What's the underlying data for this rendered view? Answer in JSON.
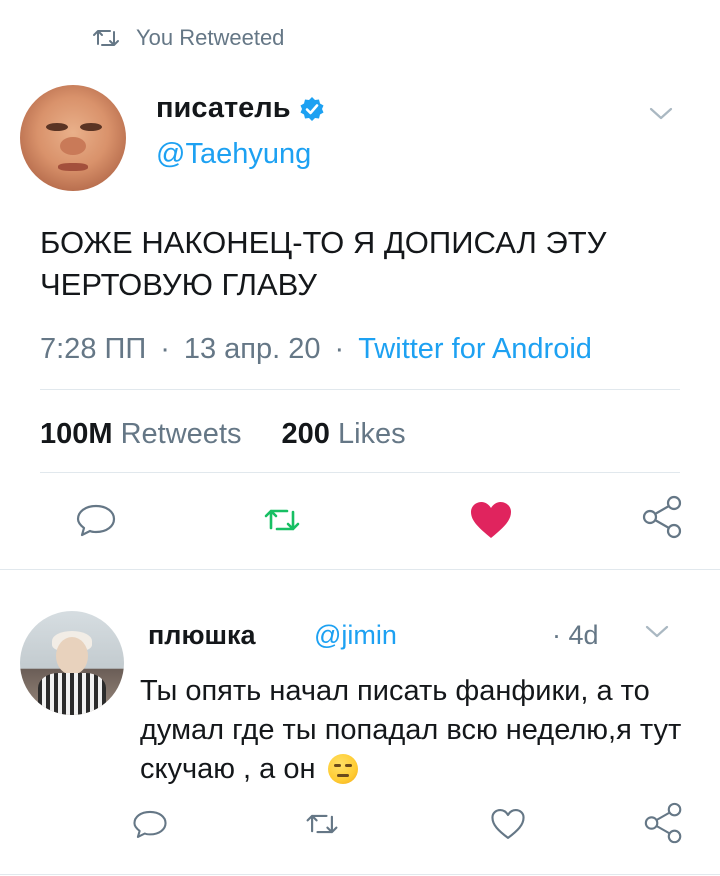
{
  "context": {
    "label": "You Retweeted",
    "icon": "retweet-icon"
  },
  "tweet": {
    "author_name": "писатель",
    "author_handle": "@Taehyung",
    "verified": true,
    "text": "БОЖЕ НАКОНЕЦ-ТО Я ДОПИСАЛ ЭТУ\nЧЕРТОВУЮ ГЛАВУ",
    "time": "7:28 ПП",
    "date": "13 апр. 20",
    "source": "Twitter for Android",
    "separator": "·",
    "stats": {
      "retweets_count": "100M",
      "retweets_label": "Retweets",
      "likes_count": "200",
      "likes_label": "Likes"
    },
    "state": {
      "retweeted": true,
      "liked": true
    }
  },
  "reply": {
    "author_name": "плюшка",
    "author_handle": "@jimin",
    "time": "· 4d",
    "text": "Ты опять начал писать фанфики, а то думал где ты попадал всю неделю,я тут скучаю , а он",
    "emoji": "expressionless-face"
  },
  "colors": {
    "accent": "#1da1f2",
    "retweet_active": "#17bf63",
    "like_active": "#e0245e",
    "secondary_text": "#657786",
    "divider": "#e1e8ed"
  }
}
